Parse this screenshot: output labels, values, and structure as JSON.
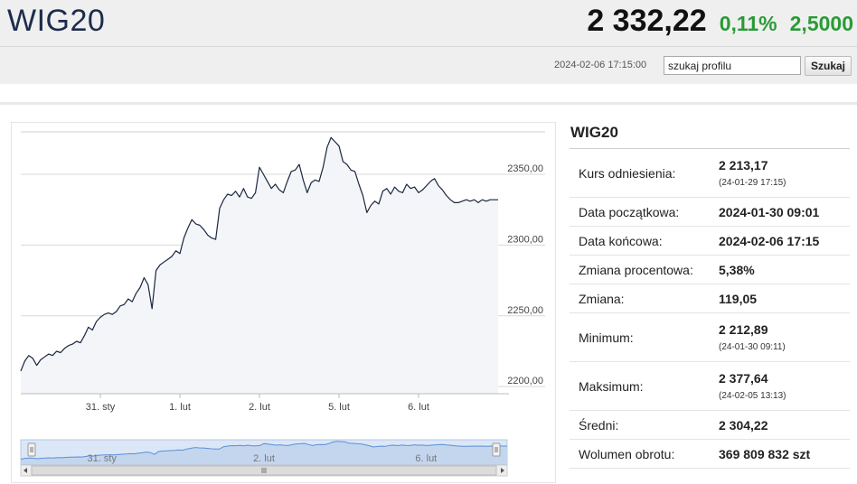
{
  "header": {
    "title": "WIG20",
    "price": "2 332,22",
    "change_pct": "0,11%",
    "change_abs": "2,5000",
    "timestamp": "2024-02-06 17:15:00",
    "search_value": "szukaj profilu",
    "search_button": "Szukaj"
  },
  "colors": {
    "up": "#2a9a36",
    "line": "#1a2740",
    "navigator": "#5b8fd6"
  },
  "panel": {
    "title": "WIG20",
    "rows": [
      {
        "label": "Kurs odniesienia:",
        "value": "2 213,17",
        "sub": "(24-01-29 17:15)"
      },
      {
        "label": "Data początkowa:",
        "value": "2024-01-30 09:01"
      },
      {
        "label": "Data końcowa:",
        "value": "2024-02-06 17:15"
      },
      {
        "label": "Zmiana procentowa:",
        "value": "5,38%"
      },
      {
        "label": "Zmiana:",
        "value": "119,05"
      },
      {
        "label": "Minimum:",
        "value": "2 212,89",
        "sub": "(24-01-30 09:11)"
      },
      {
        "label": "Maksimum:",
        "value": "2 377,64",
        "sub": "(24-02-05 13:13)"
      },
      {
        "label": "Średni:",
        "value": "2 304,22"
      },
      {
        "label": "Wolumen obrotu:",
        "value": "369 809 832 szt"
      }
    ]
  },
  "chart_data": {
    "type": "line",
    "y_ticks": [
      "2350,00",
      "2300,00",
      "2250,00",
      "2200,00"
    ],
    "y_tick_values": [
      2350,
      2300,
      2250,
      2200
    ],
    "x_ticks": [
      "31. sty",
      "1. lut",
      "2. lut",
      "5. lut",
      "6. lut"
    ],
    "x_tick_values": [
      1,
      2,
      3,
      4,
      5
    ],
    "navigator_labels": [
      "31. sty",
      "2. lut",
      "6. lut"
    ],
    "ylim": [
      2195,
      2380
    ],
    "xlim": [
      0,
      6.0
    ],
    "grid": true,
    "series": [
      {
        "x": [
          0.0,
          0.05,
          0.1,
          0.15,
          0.2,
          0.25,
          0.3,
          0.35,
          0.4,
          0.45,
          0.5,
          0.55,
          0.6,
          0.65,
          0.7,
          0.75,
          0.8,
          0.85,
          0.9,
          0.95,
          1.0,
          1.05,
          1.1,
          1.15,
          1.2,
          1.25,
          1.3,
          1.35,
          1.4,
          1.45,
          1.5,
          1.55,
          1.6,
          1.65,
          1.7,
          1.75,
          1.8,
          1.85,
          1.9,
          1.95,
          2.0,
          2.05,
          2.1,
          2.15,
          2.2,
          2.25,
          2.3,
          2.35,
          2.4,
          2.45,
          2.5,
          2.55,
          2.6,
          2.65,
          2.7,
          2.75,
          2.8,
          2.85,
          2.9,
          2.95,
          3.0,
          3.05,
          3.1,
          3.15,
          3.2,
          3.25,
          3.3,
          3.35,
          3.4,
          3.45,
          3.5,
          3.55,
          3.6,
          3.65,
          3.7,
          3.75,
          3.8,
          3.85,
          3.9,
          3.95,
          4.0,
          4.05,
          4.1,
          4.15,
          4.2,
          4.25,
          4.3,
          4.35,
          4.4,
          4.45,
          4.5,
          4.55,
          4.6,
          4.65,
          4.7,
          4.75,
          4.8,
          4.85,
          4.9,
          4.95,
          5.0,
          5.05,
          5.1,
          5.15,
          5.2,
          5.25,
          5.3,
          5.35,
          5.4,
          5.45,
          5.5,
          5.55,
          5.6,
          5.65,
          5.7,
          5.75,
          5.8,
          5.85,
          5.9,
          5.95,
          6.0
        ],
        "values": [
          2211,
          2218,
          2222,
          2220,
          2215,
          2219,
          2221,
          2223,
          2222,
          2225,
          2224,
          2227,
          2229,
          2230,
          2232,
          2231,
          2236,
          2242,
          2240,
          2246,
          2249,
          2251,
          2252,
          2251,
          2253,
          2257,
          2258,
          2262,
          2260,
          2266,
          2270,
          2277,
          2272,
          2255,
          2282,
          2286,
          2288,
          2290,
          2292,
          2296,
          2294,
          2305,
          2312,
          2318,
          2315,
          2314,
          2311,
          2307,
          2305,
          2304,
          2326,
          2332,
          2336,
          2335,
          2338,
          2334,
          2340,
          2334,
          2333,
          2337,
          2355,
          2350,
          2345,
          2340,
          2343,
          2339,
          2337,
          2345,
          2352,
          2353,
          2357,
          2346,
          2337,
          2344,
          2346,
          2345,
          2355,
          2369,
          2376,
          2373,
          2370,
          2359,
          2357,
          2353,
          2352,
          2343,
          2335,
          2323,
          2328,
          2331,
          2329,
          2338,
          2340,
          2336,
          2341,
          2338,
          2337,
          2343,
          2340,
          2341,
          2337,
          2339,
          2342,
          2345,
          2347,
          2342,
          2339,
          2335,
          2332,
          2330,
          2330,
          2331,
          2332,
          2331,
          2332,
          2330,
          2332,
          2331,
          2332,
          2332,
          2332
        ]
      }
    ]
  }
}
